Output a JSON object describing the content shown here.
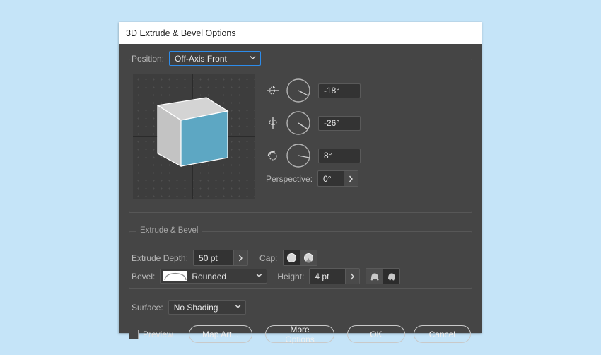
{
  "window": {
    "title": "3D Extrude & Bevel Options"
  },
  "position": {
    "label": "Position:",
    "value": "Off-Axis Front"
  },
  "rotation": {
    "x": {
      "icon": "rotate-x-axis-icon",
      "value": "-18°",
      "angle": -18
    },
    "y": {
      "icon": "rotate-y-axis-icon",
      "value": "-26°",
      "angle": -26
    },
    "z": {
      "icon": "rotate-z-axis-icon",
      "value": "8°",
      "angle": 8
    }
  },
  "perspective": {
    "label": "Perspective:",
    "value": "0°",
    "arrow": "›"
  },
  "extrude_section": {
    "legend": "Extrude & Bevel",
    "depth_label": "Extrude Depth:",
    "depth_value": "50 pt",
    "depth_arrow": "›",
    "cap_label": "Cap:",
    "bevel_label": "Bevel:",
    "bevel_value": "Rounded",
    "height_label": "Height:",
    "height_value": "4 pt",
    "height_arrow": "›"
  },
  "surface": {
    "label": "Surface:",
    "value": "No Shading"
  },
  "footer": {
    "preview_label": "Preview",
    "preview_checked": false,
    "map_art_label": "Map Art...",
    "more_options_label": "More Options",
    "ok_label": "OK",
    "cancel_label": "Cancel"
  },
  "colors": {
    "page_background": "#c5e4f8",
    "dialog_background": "#454545",
    "titlebar_background": "#ffffff",
    "accent_focus": "#2d8ceb",
    "cube_front": "#5da7c3",
    "cube_top": "#d2d2d2",
    "cube_side": "#bcbcbc",
    "field_background": "#333333"
  }
}
